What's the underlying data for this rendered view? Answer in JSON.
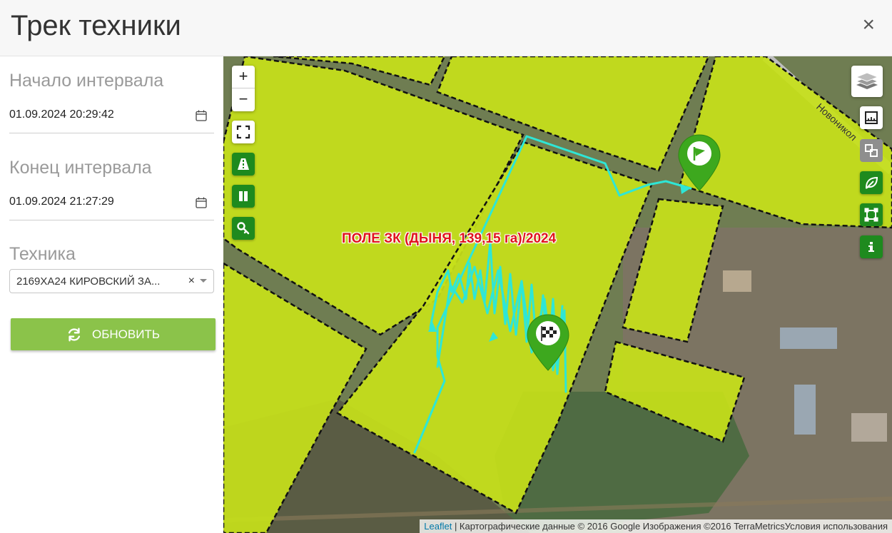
{
  "dialog": {
    "title": "Трек техники",
    "close_label": "×"
  },
  "sidebar": {
    "start": {
      "label": "Начало интервала",
      "value": "01.09.2024 20:29:42"
    },
    "end": {
      "label": "Конец интервала",
      "value": "01.09.2024 21:27:29"
    },
    "vehicle": {
      "label": "Техника",
      "value": "2169ХА24 КИРОВСКИЙ ЗА...",
      "clear": "×"
    },
    "refresh_label": "ОБНОВИТЬ"
  },
  "map": {
    "zoom_in": "+",
    "zoom_out": "−",
    "field_label": "ПОЛЕ ЗК (ДЫНЯ, 139,15 га)/2024",
    "road_label": "Новоникол",
    "attribution": {
      "leaflet": "Leaflet",
      "text": " | Картографические данные © 2016 Google Изображения ©2016 TerraMetricsУсловия использования"
    },
    "colors": {
      "field": "#c6e01a",
      "track": "#2ee6d6",
      "marker": "#3da81e",
      "control_green": "#1e8a1e"
    },
    "controls_left": [
      "fullscreen-icon",
      "road-icon",
      "columns-icon",
      "key-icon"
    ],
    "controls_right": [
      "layers-icon",
      "ruler-icon",
      "split-icon",
      "leaf-icon",
      "frame-icon",
      "info-icon"
    ]
  }
}
